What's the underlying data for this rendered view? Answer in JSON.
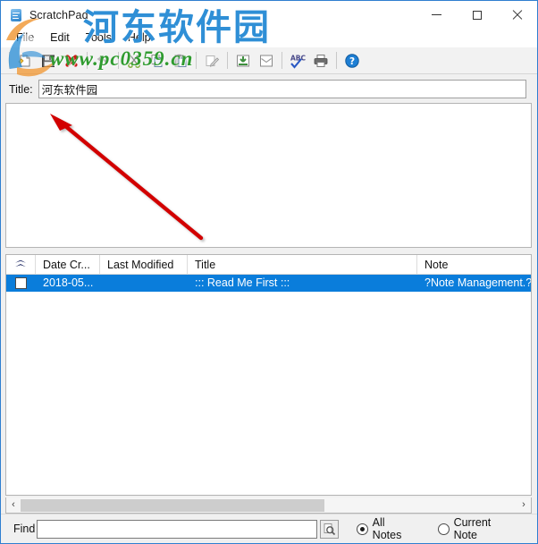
{
  "window": {
    "title": "ScratchPad",
    "icon": "scratchpad-icon",
    "minimize_label": "Minimize",
    "maximize_label": "Maximize",
    "close_label": "Close"
  },
  "menu": {
    "items": [
      {
        "label": "File"
      },
      {
        "label": "Edit"
      },
      {
        "label": "Tools"
      },
      {
        "label": "Help"
      }
    ]
  },
  "toolbar": {
    "buttons": [
      {
        "name": "new-note-button",
        "icon": "new-document-icon",
        "tooltip": "New"
      },
      {
        "name": "save-button",
        "icon": "save-disk-icon",
        "tooltip": "Save"
      },
      {
        "name": "delete-button",
        "icon": "delete-x-icon",
        "tooltip": "Delete"
      },
      {
        "name": "undo-button",
        "icon": "undo-arrow-icon",
        "tooltip": "Undo"
      },
      {
        "name": "cut-button",
        "icon": "scissors-icon",
        "tooltip": "Cut"
      },
      {
        "name": "copy-button",
        "icon": "copy-pages-icon",
        "tooltip": "Copy"
      },
      {
        "name": "paste-button",
        "icon": "paste-clipboard-icon",
        "tooltip": "Paste"
      },
      {
        "name": "edit-button",
        "icon": "pencil-edit-icon",
        "tooltip": "Edit"
      },
      {
        "name": "import-button",
        "icon": "import-down-icon",
        "tooltip": "Import"
      },
      {
        "name": "email-button",
        "icon": "envelope-icon",
        "tooltip": "Email"
      },
      {
        "name": "spellcheck-button",
        "icon": "abc-spellcheck-icon",
        "tooltip": "Spell Check"
      },
      {
        "name": "print-button",
        "icon": "printer-icon",
        "tooltip": "Print"
      },
      {
        "name": "help-button",
        "icon": "help-question-icon",
        "tooltip": "Help"
      }
    ]
  },
  "title_field": {
    "label": "Title:",
    "value": "河东软件园",
    "placeholder": ""
  },
  "editor": {
    "value": "",
    "placeholder": ""
  },
  "list": {
    "columns": [
      {
        "key": "sort",
        "label": ""
      },
      {
        "key": "date",
        "label": "Date Cr..."
      },
      {
        "key": "mod",
        "label": "Last Modified"
      },
      {
        "key": "title",
        "label": "Title"
      },
      {
        "key": "note",
        "label": "Note"
      }
    ],
    "rows": [
      {
        "checked": false,
        "selected": true,
        "date": "2018-05...",
        "mod": "",
        "title": "::: Read Me First :::",
        "note": "?Note Management.?P"
      }
    ]
  },
  "scrollbar": {
    "left_arrow": "‹",
    "right_arrow": "›"
  },
  "find": {
    "label": "Find",
    "value": "",
    "placeholder": "",
    "search_button": "search-magnifier-icon",
    "scope": [
      {
        "label": "All Notes",
        "selected": true
      },
      {
        "label": "Current Note",
        "selected": false
      }
    ]
  },
  "watermark": {
    "chinese": "河东软件园",
    "url": "www.pc0359.cn"
  },
  "colors": {
    "selection": "#0a7ddb",
    "window_border": "#2f7fd0",
    "watermark_blue": "#2f8fd6",
    "watermark_green": "#2f9b2f",
    "annotation_red": "#d20000"
  }
}
